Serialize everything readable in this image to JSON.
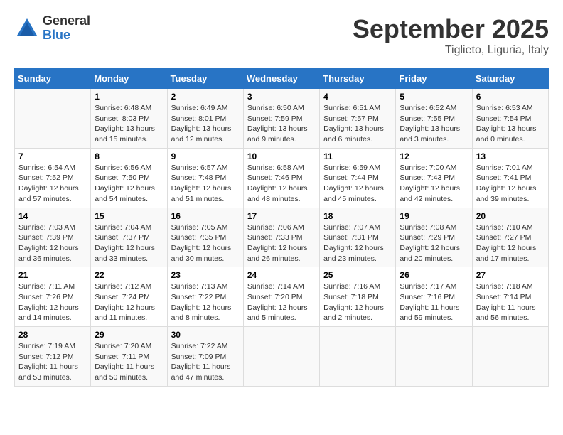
{
  "logo": {
    "general": "General",
    "blue": "Blue"
  },
  "title": {
    "month": "September 2025",
    "location": "Tiglieto, Liguria, Italy"
  },
  "days_of_week": [
    "Sunday",
    "Monday",
    "Tuesday",
    "Wednesday",
    "Thursday",
    "Friday",
    "Saturday"
  ],
  "weeks": [
    [
      {
        "num": "",
        "info": ""
      },
      {
        "num": "1",
        "info": "Sunrise: 6:48 AM\nSunset: 8:03 PM\nDaylight: 13 hours and 15 minutes."
      },
      {
        "num": "2",
        "info": "Sunrise: 6:49 AM\nSunset: 8:01 PM\nDaylight: 13 hours and 12 minutes."
      },
      {
        "num": "3",
        "info": "Sunrise: 6:50 AM\nSunset: 7:59 PM\nDaylight: 13 hours and 9 minutes."
      },
      {
        "num": "4",
        "info": "Sunrise: 6:51 AM\nSunset: 7:57 PM\nDaylight: 13 hours and 6 minutes."
      },
      {
        "num": "5",
        "info": "Sunrise: 6:52 AM\nSunset: 7:55 PM\nDaylight: 13 hours and 3 minutes."
      },
      {
        "num": "6",
        "info": "Sunrise: 6:53 AM\nSunset: 7:54 PM\nDaylight: 13 hours and 0 minutes."
      }
    ],
    [
      {
        "num": "7",
        "info": "Sunrise: 6:54 AM\nSunset: 7:52 PM\nDaylight: 12 hours and 57 minutes."
      },
      {
        "num": "8",
        "info": "Sunrise: 6:56 AM\nSunset: 7:50 PM\nDaylight: 12 hours and 54 minutes."
      },
      {
        "num": "9",
        "info": "Sunrise: 6:57 AM\nSunset: 7:48 PM\nDaylight: 12 hours and 51 minutes."
      },
      {
        "num": "10",
        "info": "Sunrise: 6:58 AM\nSunset: 7:46 PM\nDaylight: 12 hours and 48 minutes."
      },
      {
        "num": "11",
        "info": "Sunrise: 6:59 AM\nSunset: 7:44 PM\nDaylight: 12 hours and 45 minutes."
      },
      {
        "num": "12",
        "info": "Sunrise: 7:00 AM\nSunset: 7:43 PM\nDaylight: 12 hours and 42 minutes."
      },
      {
        "num": "13",
        "info": "Sunrise: 7:01 AM\nSunset: 7:41 PM\nDaylight: 12 hours and 39 minutes."
      }
    ],
    [
      {
        "num": "14",
        "info": "Sunrise: 7:03 AM\nSunset: 7:39 PM\nDaylight: 12 hours and 36 minutes."
      },
      {
        "num": "15",
        "info": "Sunrise: 7:04 AM\nSunset: 7:37 PM\nDaylight: 12 hours and 33 minutes."
      },
      {
        "num": "16",
        "info": "Sunrise: 7:05 AM\nSunset: 7:35 PM\nDaylight: 12 hours and 30 minutes."
      },
      {
        "num": "17",
        "info": "Sunrise: 7:06 AM\nSunset: 7:33 PM\nDaylight: 12 hours and 26 minutes."
      },
      {
        "num": "18",
        "info": "Sunrise: 7:07 AM\nSunset: 7:31 PM\nDaylight: 12 hours and 23 minutes."
      },
      {
        "num": "19",
        "info": "Sunrise: 7:08 AM\nSunset: 7:29 PM\nDaylight: 12 hours and 20 minutes."
      },
      {
        "num": "20",
        "info": "Sunrise: 7:10 AM\nSunset: 7:27 PM\nDaylight: 12 hours and 17 minutes."
      }
    ],
    [
      {
        "num": "21",
        "info": "Sunrise: 7:11 AM\nSunset: 7:26 PM\nDaylight: 12 hours and 14 minutes."
      },
      {
        "num": "22",
        "info": "Sunrise: 7:12 AM\nSunset: 7:24 PM\nDaylight: 12 hours and 11 minutes."
      },
      {
        "num": "23",
        "info": "Sunrise: 7:13 AM\nSunset: 7:22 PM\nDaylight: 12 hours and 8 minutes."
      },
      {
        "num": "24",
        "info": "Sunrise: 7:14 AM\nSunset: 7:20 PM\nDaylight: 12 hours and 5 minutes."
      },
      {
        "num": "25",
        "info": "Sunrise: 7:16 AM\nSunset: 7:18 PM\nDaylight: 12 hours and 2 minutes."
      },
      {
        "num": "26",
        "info": "Sunrise: 7:17 AM\nSunset: 7:16 PM\nDaylight: 11 hours and 59 minutes."
      },
      {
        "num": "27",
        "info": "Sunrise: 7:18 AM\nSunset: 7:14 PM\nDaylight: 11 hours and 56 minutes."
      }
    ],
    [
      {
        "num": "28",
        "info": "Sunrise: 7:19 AM\nSunset: 7:12 PM\nDaylight: 11 hours and 53 minutes."
      },
      {
        "num": "29",
        "info": "Sunrise: 7:20 AM\nSunset: 7:11 PM\nDaylight: 11 hours and 50 minutes."
      },
      {
        "num": "30",
        "info": "Sunrise: 7:22 AM\nSunset: 7:09 PM\nDaylight: 11 hours and 47 minutes."
      },
      {
        "num": "",
        "info": ""
      },
      {
        "num": "",
        "info": ""
      },
      {
        "num": "",
        "info": ""
      },
      {
        "num": "",
        "info": ""
      }
    ]
  ]
}
